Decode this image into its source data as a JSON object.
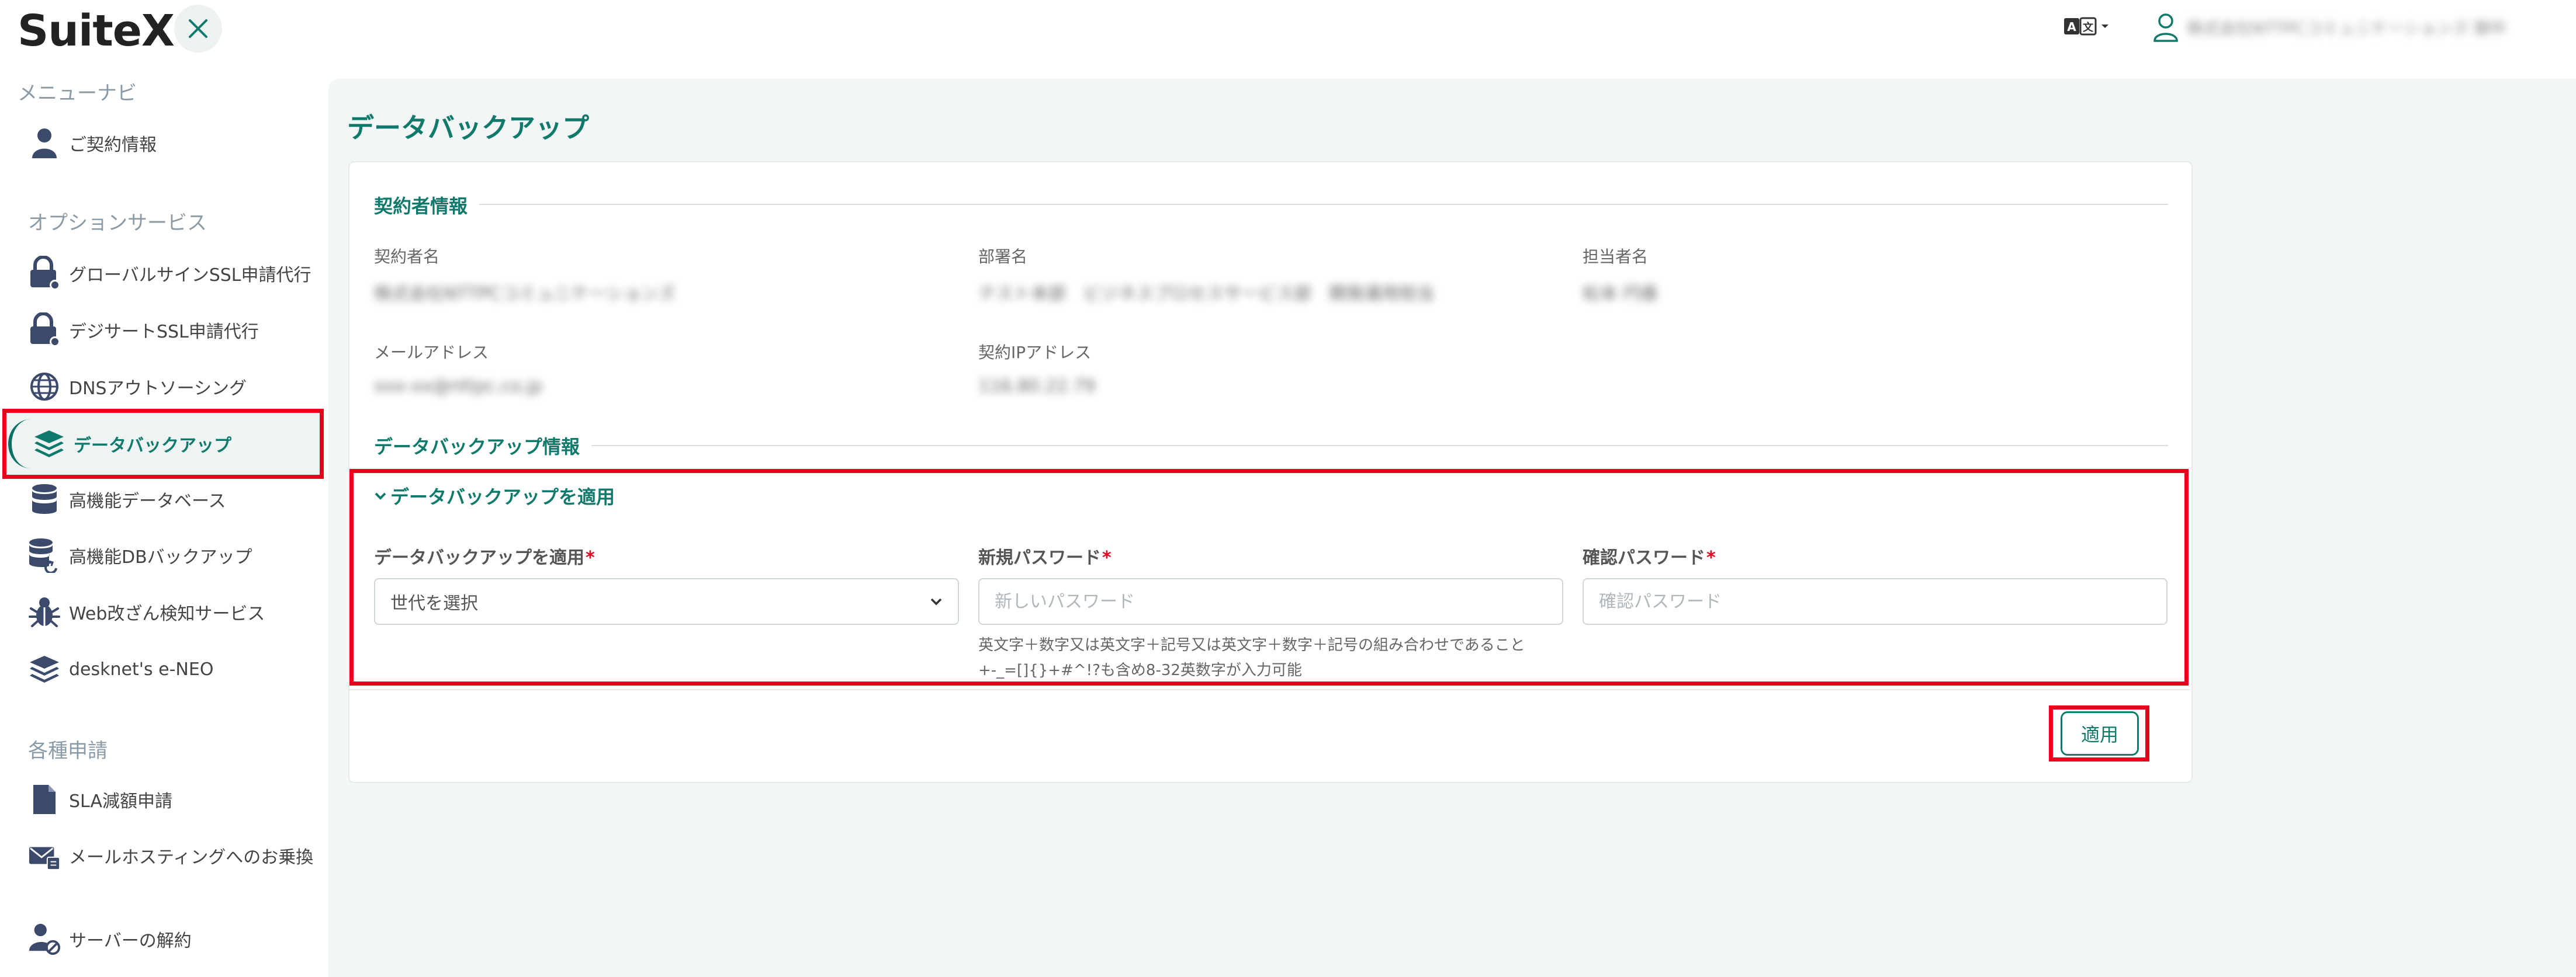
{
  "header": {
    "logo": "SuiteX",
    "user_name": "株式会社NTTPCコミュニケーションズ 御中"
  },
  "sidebar": {
    "menu_title": "メニューナビ",
    "contract_item": "ご契約情報",
    "option_title": "オプションサービス",
    "option_items": [
      "グローバルサインSSL申請代行",
      "デジサートSSL申請代行",
      "DNSアウトソーシング",
      "データバックアップ",
      "高機能データベース",
      "高機能DBバックアップ",
      "Web改ざん検知サービス",
      "desknet's e-NEO"
    ],
    "apply_title": "各種申請",
    "apply_items": [
      "SLA減額申請",
      "メールホスティングへのお乗換"
    ],
    "cancel_item": "サーバーの解約",
    "active_item": "データバックアップ"
  },
  "main": {
    "title": "データバックアップ",
    "contractor_section": "契約者情報",
    "labels": {
      "contractor_name": "契約者名",
      "department": "部署名",
      "person": "担当者名",
      "email": "メールアドレス",
      "ip": "契約IPアドレス"
    },
    "values": {
      "contractor_name": "株式会社NTTPCコミュニケーションズ",
      "department": "テスト本部　ビジネスプロセスサービス部　開発運用担当",
      "person": "松本 円香",
      "email": "xxx-xx@nttpc.co.jp",
      "ip": "116.80.22.79"
    },
    "backup_section": "データバックアップ情報",
    "accordion_label": "データバックアップを適用",
    "form": {
      "apply_label": "データバックアップを適用",
      "select_placeholder": "世代を選択",
      "new_pw_label": "新規パスワード",
      "new_pw_placeholder": "新しいパスワード",
      "confirm_pw_label": "確認パスワード",
      "confirm_pw_placeholder": "確認パスワード",
      "hint_line1": "英文字＋数字又は英文字＋記号又は英文字＋数字＋記号の組み合わせであること",
      "hint_line2": "+-_=[]{}+#^!?も含め8-32英数字が入力可能",
      "required_mark": "*"
    },
    "apply_button": "適用"
  },
  "colors": {
    "accent": "#0f7a6c",
    "highlight": "#e8001c",
    "icon": "#3b4a6b"
  }
}
